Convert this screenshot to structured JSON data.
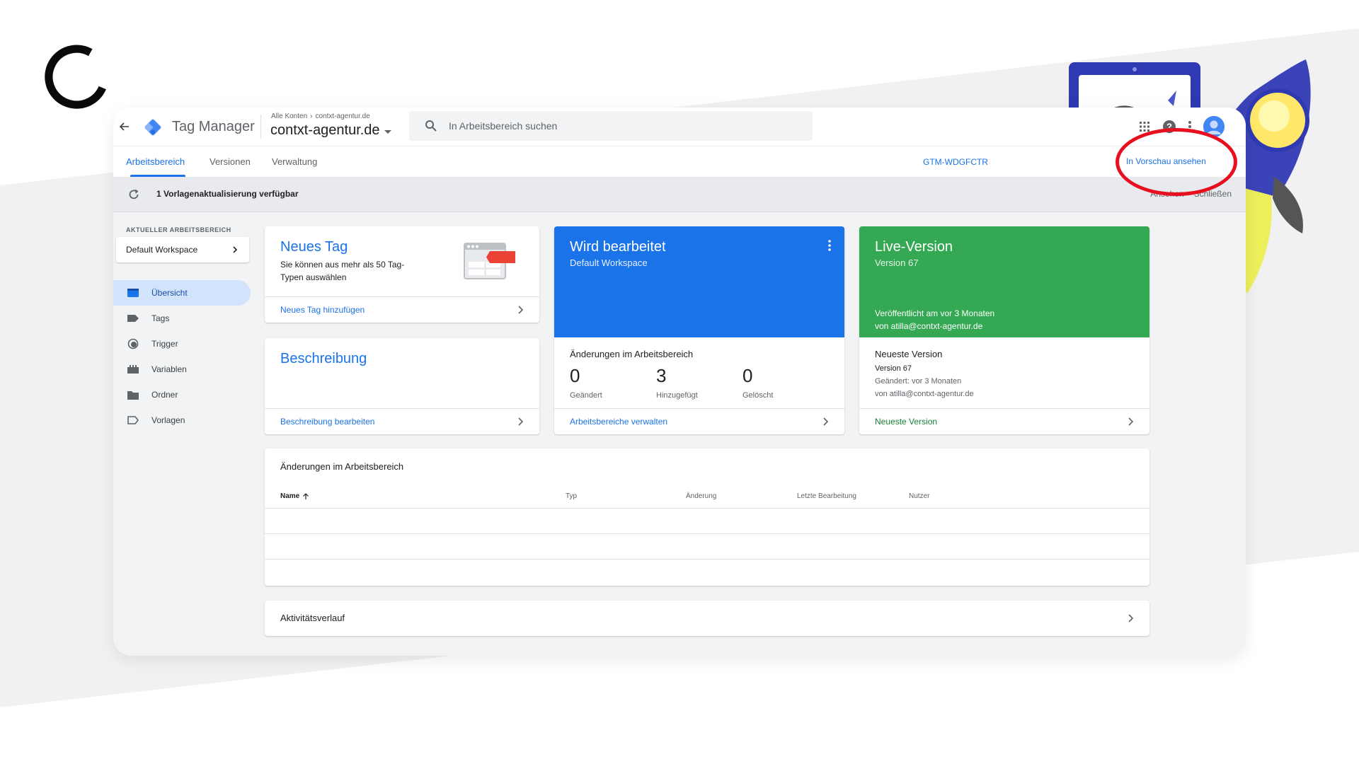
{
  "header": {
    "product_name": "Tag Manager",
    "breadcrumb_all": "Alle Konten",
    "breadcrumb_container": "contxt-agentur.de",
    "container_name": "contxt-agentur.de",
    "search_placeholder": "In Arbeitsbereich suchen"
  },
  "tabs": {
    "workspace": "Arbeitsbereich",
    "versions": "Versionen",
    "admin": "Verwaltung"
  },
  "container_id": "GTM-WDGFCTR",
  "preview_label": "In Vorschau ansehen",
  "notice": {
    "text": "1 Vorlagenaktualisierung verfügbar",
    "action_view": "Ansehen",
    "action_close": "Schließen"
  },
  "sidebar": {
    "workspace_label": "AKTUELLER ARBEITSBEREICH",
    "workspace_name": "Default Workspace",
    "items": [
      {
        "label": "Übersicht"
      },
      {
        "label": "Tags"
      },
      {
        "label": "Trigger"
      },
      {
        "label": "Variablen"
      },
      {
        "label": "Ordner"
      },
      {
        "label": "Vorlagen"
      }
    ]
  },
  "new_tag": {
    "title": "Neues Tag",
    "desc": "Sie können aus mehr als 50 Tag-Typen auswählen",
    "link": "Neues Tag hinzufügen"
  },
  "description": {
    "title": "Beschreibung",
    "link": "Beschreibung bearbeiten"
  },
  "editing": {
    "title": "Wird bearbeitet",
    "subtitle": "Default Workspace",
    "changes_title": "Änderungen im Arbeitsbereich",
    "stats": [
      {
        "value": "0",
        "label": "Geändert"
      },
      {
        "value": "3",
        "label": "Hinzugefügt"
      },
      {
        "value": "0",
        "label": "Gelöscht"
      }
    ],
    "link": "Arbeitsbereiche verwalten"
  },
  "live": {
    "title": "Live-Version",
    "subtitle": "Version 67",
    "published": "Veröffentlicht am vor 3 Monaten",
    "published_by": "von atilla@contxt-agentur.de",
    "latest_title": "Neueste Version",
    "latest_version": "Version 67",
    "latest_changed": "Geändert: vor 3 Monaten",
    "latest_by": "von atilla@contxt-agentur.de",
    "link": "Neueste Version"
  },
  "changes_table": {
    "title": "Änderungen im Arbeitsbereich",
    "columns": [
      "Name",
      "Typ",
      "Änderung",
      "Letzte Bearbeitung",
      "Nutzer"
    ]
  },
  "activity": {
    "title": "Aktivitätsverlauf"
  },
  "colors": {
    "accent": "#1a73e8",
    "editing_card": "#1a73e8",
    "live_card": "#34a853",
    "annotation": "#e8101e"
  }
}
